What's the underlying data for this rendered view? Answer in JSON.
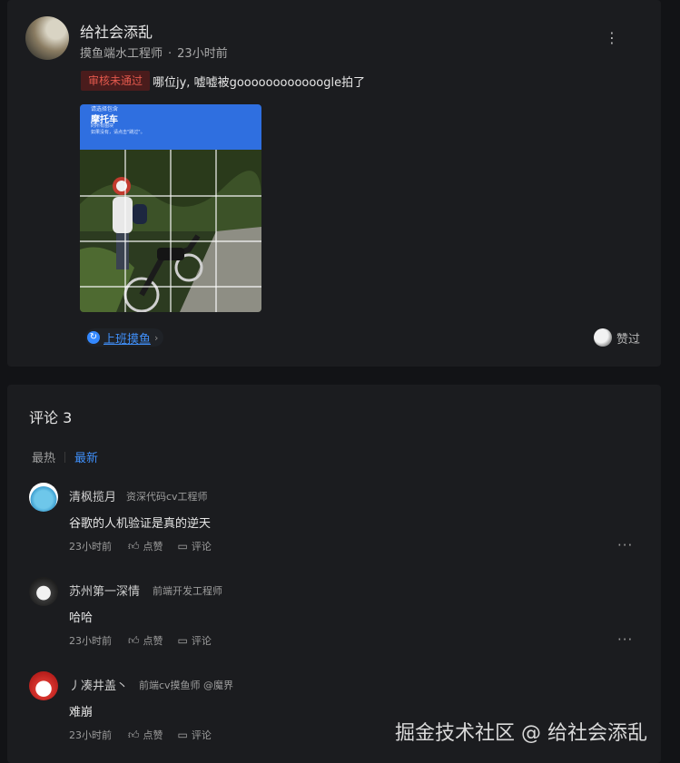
{
  "post": {
    "author": "给社会添乱",
    "author_title": "摸鱼端水工程师",
    "separator": "·",
    "time": "23小时前",
    "badge": "审核未通过",
    "text": "哪位jy, 嘘嘘被goooooooooooogle拍了",
    "captcha": {
      "line1": "请选择包含",
      "line2": "摩托车",
      "line3": "的所有图块",
      "line4": "如果没有，请点击\"跳过\"。"
    },
    "topic": "上班摸鱼",
    "topic_icon": "refresh-icon",
    "topic_chevron": "›",
    "like_label": "赞过",
    "more_icon": "⋮"
  },
  "comments": {
    "title": "评论 3",
    "sort": {
      "hot": "最热",
      "new": "最新"
    },
    "action_like": "点赞",
    "action_comment": "评论",
    "action_more": "···",
    "items": [
      {
        "name": "清枫揽月",
        "title": "资深代码cv工程师",
        "text": "谷歌的人机验证是真的逆天",
        "time": "23小时前"
      },
      {
        "name": "苏州第一深情",
        "title": "前端开发工程师",
        "text": "哈哈",
        "time": "23小时前"
      },
      {
        "name": "丿凑井盖丶",
        "title": "前端cv摸鱼师 @魔界",
        "text": "难崩",
        "time": "23小时前"
      }
    ]
  },
  "watermark": "掘金技术社区 @ 给社会添乱",
  "colors": {
    "accent": "#3f8ef7",
    "badge_text": "#e2584c",
    "badge_bg": "#4a1c1c",
    "captcha_header": "#2f6fe0"
  }
}
